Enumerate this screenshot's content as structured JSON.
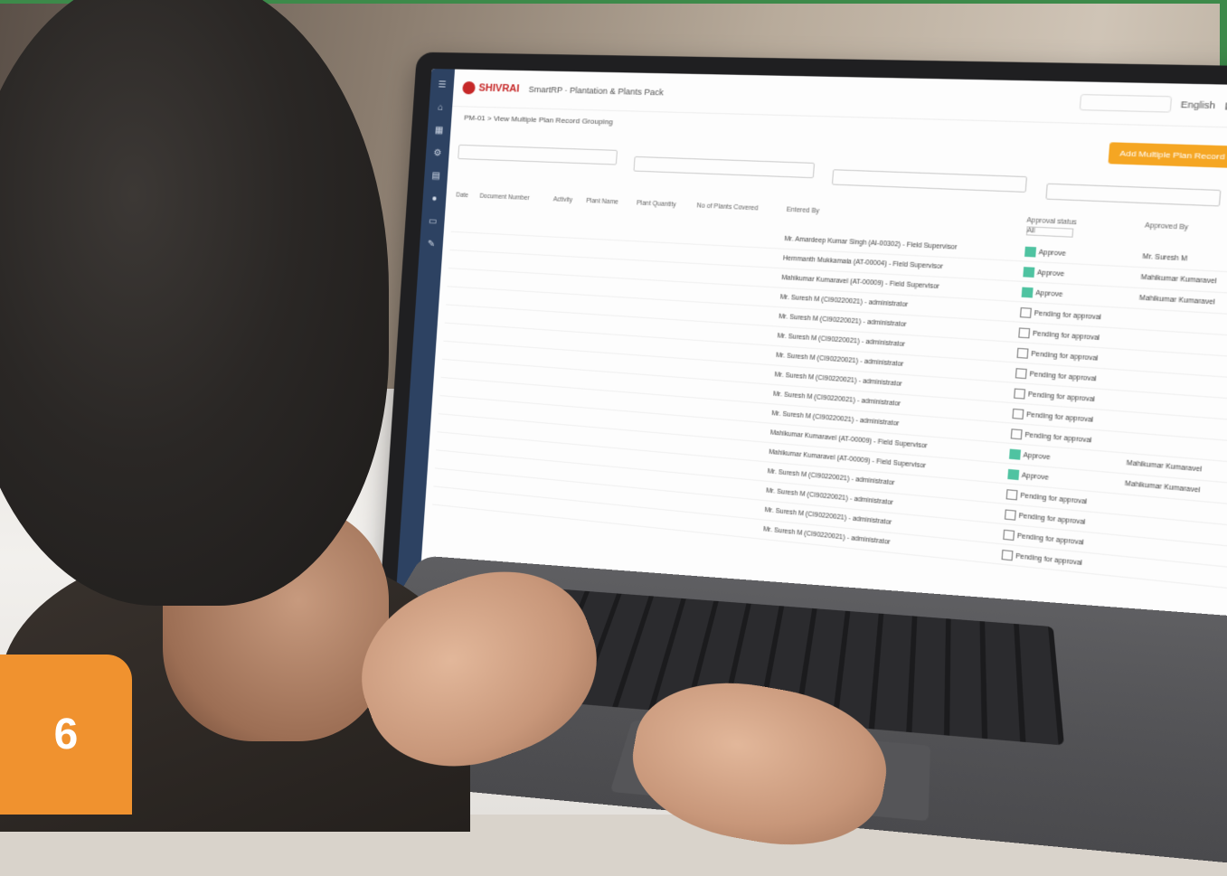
{
  "badge_number": "6",
  "app": {
    "brand": "SHIVRAI",
    "module_title": "SmartRP · Plantation & Plants Pack",
    "breadcrumb": "PM-01 > View Multiple Plan Record Grouping",
    "language": "English",
    "add_button": "Add Multiple Plan Record Grouping"
  },
  "table": {
    "columns": [
      "Date",
      "Document Number",
      "Activity",
      "Plant Name",
      "Plant Quantity",
      "No of Plants Covered",
      "Entered By",
      "Approval status",
      "Approved By"
    ],
    "status_filter": "All",
    "rows": [
      {
        "status": "Approve",
        "approved": true,
        "by": "Mr. Amardeep Kumar Singh (AI-00302) - Field Supervisor",
        "approver": "Mr. Suresh M"
      },
      {
        "status": "Approve",
        "approved": true,
        "by": "Hemmanth Mukkamala (AT-00004) - Field Supervisor",
        "approver": "Mahikumar Kumaravel"
      },
      {
        "status": "Approve",
        "approved": true,
        "by": "Mahikumar Kumaravel (AT-00009) - Field Supervisor",
        "approver": "Mahikumar Kumaravel"
      },
      {
        "status": "Pending for approval",
        "approved": false,
        "by": "Mr. Suresh M (CI90220021) - administrator",
        "approver": ""
      },
      {
        "status": "Pending for approval",
        "approved": false,
        "by": "Mr. Suresh M (CI90220021) - administrator",
        "approver": ""
      },
      {
        "status": "Pending for approval",
        "approved": false,
        "by": "Mr. Suresh M (CI90220021) - administrator",
        "approver": ""
      },
      {
        "status": "Pending for approval",
        "approved": false,
        "by": "Mr. Suresh M (CI90220021) - administrator",
        "approver": ""
      },
      {
        "status": "Pending for approval",
        "approved": false,
        "by": "Mr. Suresh M (CI90220021) - administrator",
        "approver": ""
      },
      {
        "status": "Pending for approval",
        "approved": false,
        "by": "Mr. Suresh M (CI90220021) - administrator",
        "approver": ""
      },
      {
        "status": "Pending for approval",
        "approved": false,
        "by": "Mr. Suresh M (CI90220021) - administrator",
        "approver": ""
      },
      {
        "status": "Approve",
        "approved": true,
        "by": "Mahikumar Kumaravel (AT-00009) - Field Supervisor",
        "approver": "Mahikumar Kumaravel"
      },
      {
        "status": "Approve",
        "approved": true,
        "by": "Mahikumar Kumaravel (AT-00009) - Field Supervisor",
        "approver": "Mahikumar Kumaravel"
      },
      {
        "status": "Pending for approval",
        "approved": false,
        "by": "Mr. Suresh M (CI90220021) - administrator",
        "approver": ""
      },
      {
        "status": "Pending for approval",
        "approved": false,
        "by": "Mr. Suresh M (CI90220021) - administrator",
        "approver": ""
      },
      {
        "status": "Pending for approval",
        "approved": false,
        "by": "Mr. Suresh M (CI90220021) - administrator",
        "approver": ""
      },
      {
        "status": "Pending for approval",
        "approved": false,
        "by": "Mr. Suresh M (CI90220021) - administrator",
        "approver": ""
      }
    ]
  },
  "colors": {
    "accent": "#f0922f",
    "frame": "#3d8a4a",
    "sidebar": "#2d4262",
    "approved": "#4fc3a1"
  }
}
